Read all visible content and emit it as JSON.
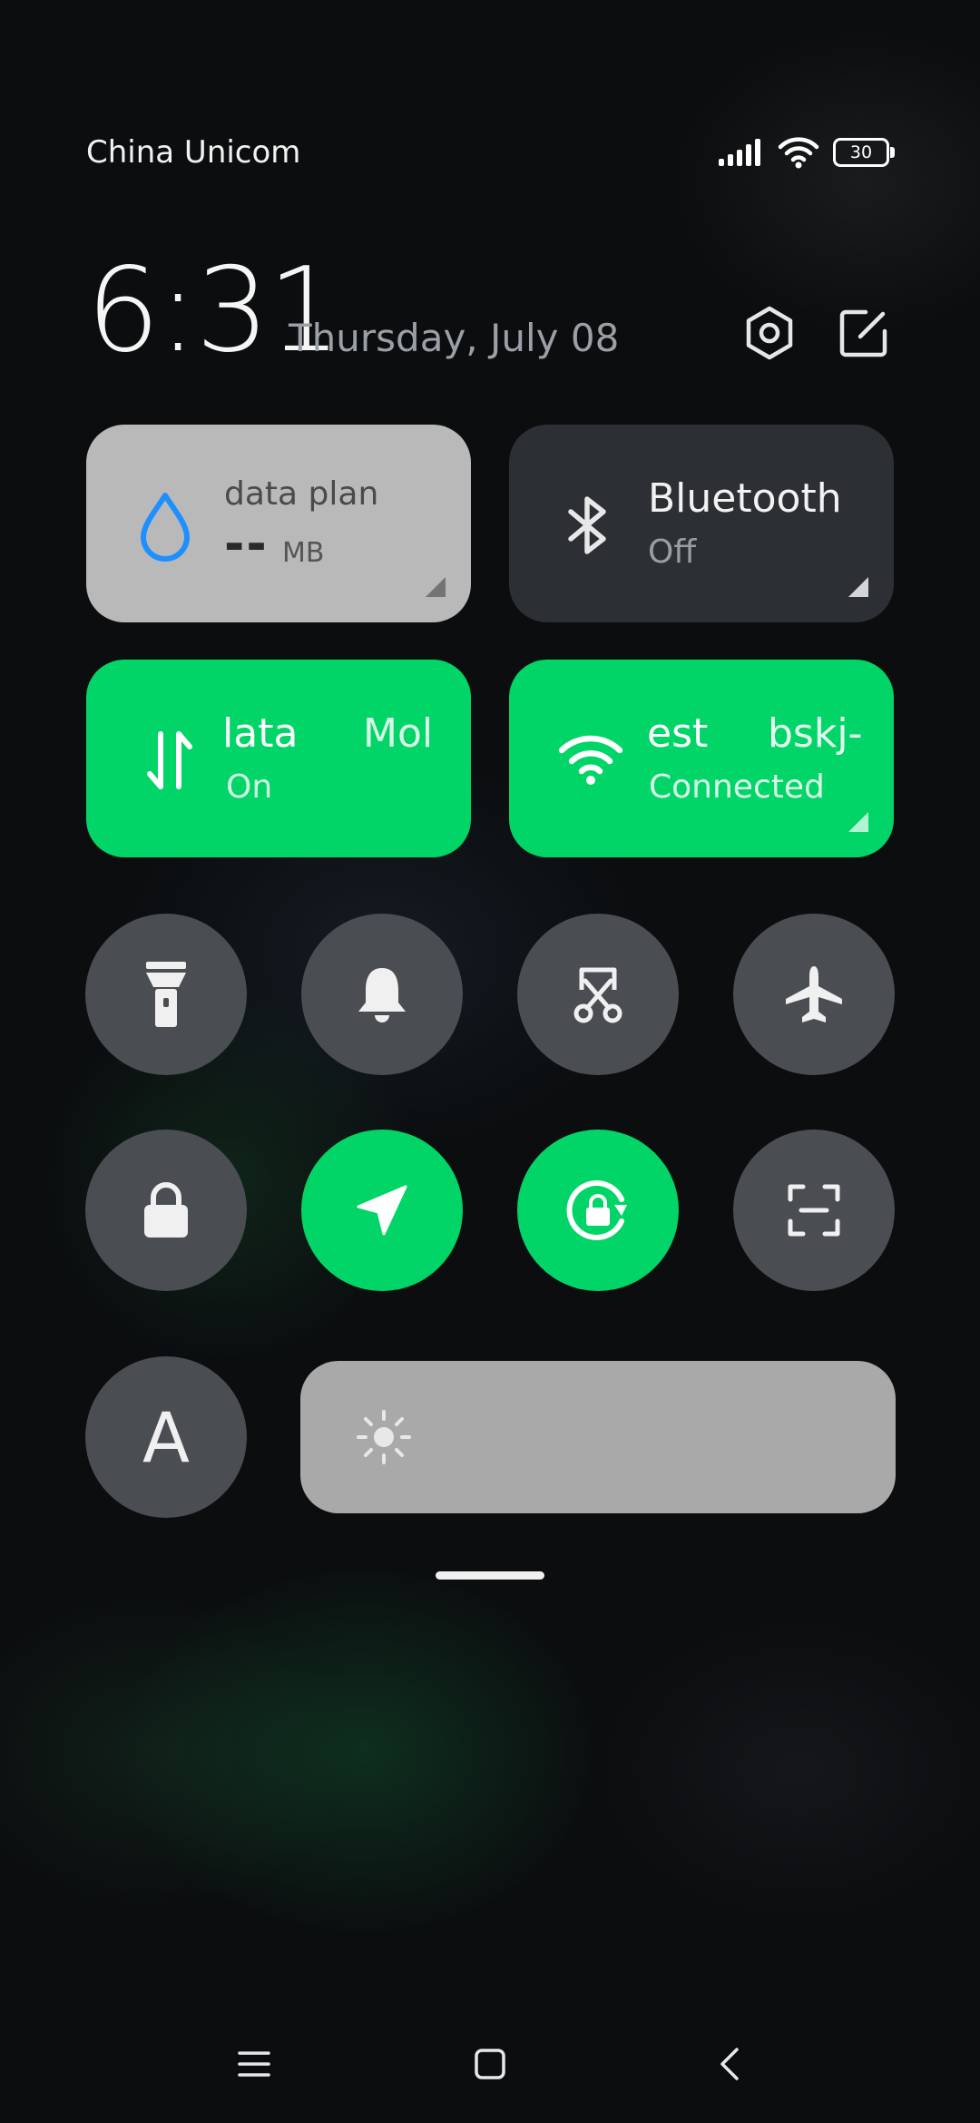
{
  "status_bar": {
    "carrier": "China Unicom",
    "battery": "30",
    "signal_icon": "signal-bars-icon",
    "wifi_icon": "wifi-icon"
  },
  "header": {
    "time": "6:31",
    "date": "Thursday, July 08",
    "settings_icon": "settings-gear-icon",
    "edit_icon": "edit-icon"
  },
  "tiles": {
    "data_plan": {
      "title": "data plan",
      "value": "--",
      "unit": "MB",
      "icon": "water-drop-icon"
    },
    "bluetooth": {
      "title": "Bluetooth",
      "status": "Off",
      "icon": "bluetooth-icon"
    },
    "mobile_data": {
      "title_left": "lata",
      "title_right": "Mol",
      "status": "On",
      "icon": "data-arrows-icon"
    },
    "wifi": {
      "title_left": "est",
      "title_right": "bskj-",
      "status": "Connected",
      "icon": "wifi-icon"
    }
  },
  "toggles": [
    {
      "name": "flashlight",
      "icon": "flashlight-icon",
      "on": false
    },
    {
      "name": "silent",
      "icon": "bell-icon",
      "on": false
    },
    {
      "name": "screenshot",
      "icon": "scissors-screenshot-icon",
      "on": false
    },
    {
      "name": "airplane-mode",
      "icon": "airplane-icon",
      "on": false
    },
    {
      "name": "lock-screen",
      "icon": "lock-icon",
      "on": false
    },
    {
      "name": "location",
      "icon": "location-arrow-icon",
      "on": true
    },
    {
      "name": "rotation-lock",
      "icon": "rotation-lock-icon",
      "on": true
    },
    {
      "name": "scanner",
      "icon": "scan-frame-icon",
      "on": false
    }
  ],
  "bottom": {
    "auto_brightness_label": "A",
    "brightness_icon": "sun-icon"
  },
  "colors": {
    "accent_green": "#02d567",
    "tile_dark": "#2c2f33",
    "tile_light": "#b9b9b9",
    "toggle_off": "#4a4d52",
    "data_drop_blue": "#1e8fff"
  },
  "nav": {
    "menu_icon": "menu-icon",
    "home_icon": "home-square-icon",
    "back_icon": "back-chevron-icon"
  }
}
